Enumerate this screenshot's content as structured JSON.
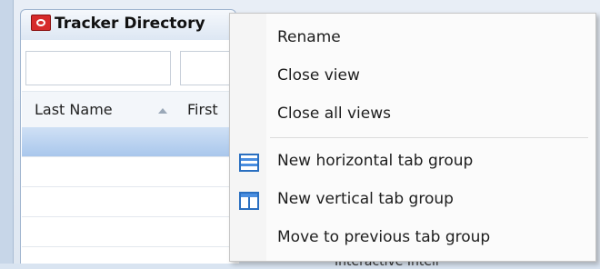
{
  "tab": {
    "title": "Tracker Directory",
    "icon": "tracker-app-icon"
  },
  "grid": {
    "columns": [
      "Last Name",
      "First"
    ],
    "sort_icon": "sort-ascending-icon"
  },
  "context_menu": {
    "items": [
      {
        "label": "Rename"
      },
      {
        "label": "Close view"
      },
      {
        "label": "Close all views"
      },
      {
        "label": "New horizontal tab group",
        "icon": "horizontal-tab-group-icon"
      },
      {
        "label": "New vertical tab group",
        "icon": "vertical-tab-group-icon"
      },
      {
        "label": "Move to previous tab group"
      }
    ]
  },
  "background_text": "Interactive Intell"
}
